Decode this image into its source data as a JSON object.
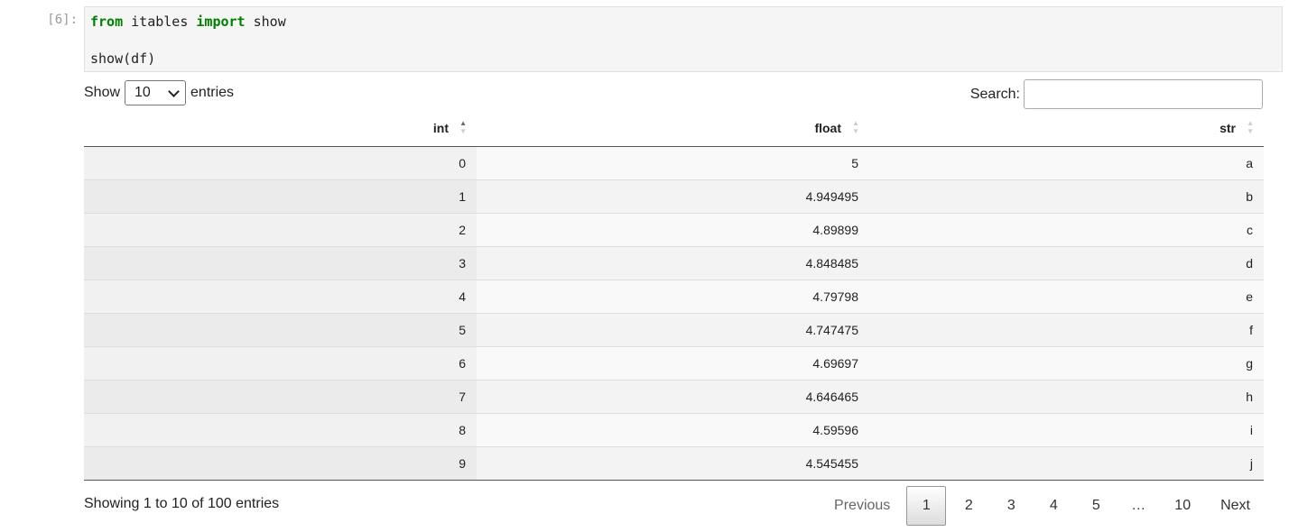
{
  "cell": {
    "prompt": "[6]:",
    "code_lines": [
      [
        {
          "t": "from",
          "kw": true
        },
        {
          "t": " itables ",
          "kw": false
        },
        {
          "t": "import",
          "kw": true
        },
        {
          "t": " show",
          "kw": false
        }
      ],
      [
        {
          "t": "show(df)",
          "kw": false
        }
      ]
    ]
  },
  "controls": {
    "show_label": "Show",
    "page_length": "10",
    "entries_label": "entries",
    "search_label": "Search:",
    "search_value": ""
  },
  "table": {
    "columns": [
      {
        "label": "int",
        "sorted": "asc"
      },
      {
        "label": "float",
        "sorted": "none"
      },
      {
        "label": "str",
        "sorted": "none"
      }
    ],
    "rows": [
      [
        "0",
        "5",
        "a"
      ],
      [
        "1",
        "4.949495",
        "b"
      ],
      [
        "2",
        "4.89899",
        "c"
      ],
      [
        "3",
        "4.848485",
        "d"
      ],
      [
        "4",
        "4.79798",
        "e"
      ],
      [
        "5",
        "4.747475",
        "f"
      ],
      [
        "6",
        "4.69697",
        "g"
      ],
      [
        "7",
        "4.646465",
        "h"
      ],
      [
        "8",
        "4.59596",
        "i"
      ],
      [
        "9",
        "4.545455",
        "j"
      ]
    ]
  },
  "footer": {
    "info": "Showing 1 to 10 of 100 entries",
    "previous": "Previous",
    "pages": [
      "1",
      "2",
      "3",
      "4",
      "5",
      "…",
      "10"
    ],
    "current_page": "1",
    "next": "Next"
  },
  "colors": {
    "keyword": "#008000",
    "code_bg": "#f5f5f5",
    "prompt": "#999999"
  }
}
